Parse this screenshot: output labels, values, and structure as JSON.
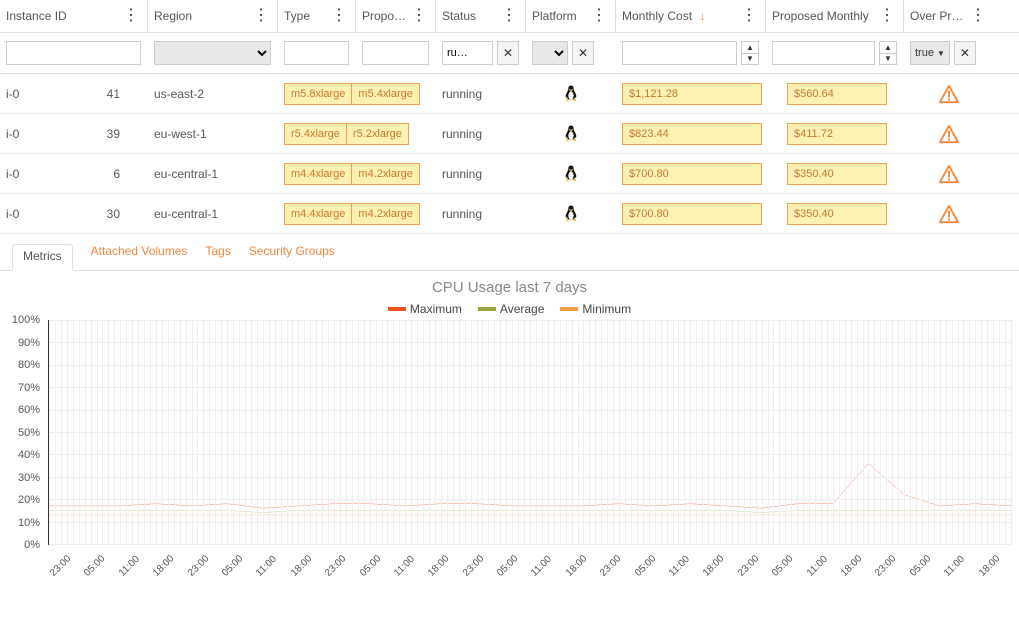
{
  "columns": {
    "instance_id": "Instance ID",
    "region": "Region",
    "type": "Type",
    "proposed": "Propos…",
    "status": "Status",
    "platform": "Platform",
    "monthly_cost": "Monthly Cost",
    "proposed_monthly": "Proposed Monthly",
    "over_prov": "Over Prov…"
  },
  "filters": {
    "status_value": "ru…",
    "over_value": "true"
  },
  "rows": [
    {
      "id_a": "i-0",
      "id_b": "41",
      "region": "us-east-2",
      "type": "m5.8xlarge",
      "proposed": "m5.4xlarge",
      "status": "running",
      "platform": "linux",
      "cost": "$1,121.28",
      "pcost": "$560.64"
    },
    {
      "id_a": "i-0",
      "id_b": "39",
      "region": "eu-west-1",
      "type": "r5.4xlarge",
      "proposed": "r5.2xlarge",
      "status": "running",
      "platform": "linux",
      "cost": "$823.44",
      "pcost": "$411.72"
    },
    {
      "id_a": "i-0",
      "id_b": "6",
      "region": "eu-central-1",
      "type": "m4.4xlarge",
      "proposed": "m4.2xlarge",
      "status": "running",
      "platform": "linux",
      "cost": "$700.80",
      "pcost": "$350.40"
    },
    {
      "id_a": "i-0",
      "id_b": "30",
      "region": "eu-central-1",
      "type": "m4.4xlarge",
      "proposed": "m4.2xlarge",
      "status": "running",
      "platform": "linux",
      "cost": "$700.80",
      "pcost": "$350.40"
    }
  ],
  "tabs": {
    "metrics": "Metrics",
    "volumes": "Attached Volumes",
    "tags": "Tags",
    "security": "Security Groups"
  },
  "chart": {
    "title": "CPU Usage last 7 days",
    "legend": {
      "max": "Maximum",
      "avg": "Average",
      "min": "Minimum"
    }
  },
  "chart_data": {
    "type": "line",
    "title": "CPU Usage last 7 days",
    "xlabel": "",
    "ylabel": "%",
    "ylim": [
      0,
      100
    ],
    "x_ticks": [
      "23:00",
      "05:00",
      "11:00",
      "18:00",
      "23:00",
      "05:00",
      "11:00",
      "18:00",
      "23:00",
      "05:00",
      "11:00",
      "18:00",
      "23:00",
      "05:00",
      "11:00",
      "18:00",
      "23:00",
      "05:00",
      "11:00",
      "18:00",
      "23:00",
      "05:00",
      "11:00",
      "18:00",
      "23:00",
      "05:00",
      "11:00",
      "18:00"
    ],
    "y_ticks": [
      0,
      10,
      20,
      30,
      40,
      50,
      60,
      70,
      80,
      90,
      100
    ],
    "series": [
      {
        "name": "Maximum",
        "color": "#e8531f",
        "values": [
          17,
          17,
          17,
          18,
          17,
          18,
          16,
          17,
          18,
          18,
          17,
          18,
          18,
          17,
          17,
          17,
          18,
          17,
          18,
          17,
          16,
          18,
          18,
          36,
          22,
          17,
          18,
          17
        ]
      },
      {
        "name": "Average",
        "color": "#9aa63d",
        "values": [
          15,
          15,
          15,
          15,
          15,
          15,
          14,
          15,
          15,
          15,
          15,
          15,
          15,
          15,
          15,
          15,
          15,
          15,
          15,
          15,
          14,
          15,
          15,
          15,
          15,
          15,
          15,
          15
        ]
      },
      {
        "name": "Minimum",
        "color": "#f29c4b",
        "values": [
          13,
          13,
          13,
          13,
          13,
          13,
          13,
          13,
          13,
          13,
          13,
          13,
          13,
          13,
          13,
          13,
          13,
          13,
          13,
          13,
          13,
          13,
          13,
          13,
          13,
          13,
          13,
          13
        ]
      }
    ]
  },
  "icons": {
    "clear": "✕",
    "up": "▲",
    "down": "▼",
    "menu": "⋮",
    "sort_down": "↓",
    "select_arrow": "▼",
    "warning": "⚠"
  }
}
